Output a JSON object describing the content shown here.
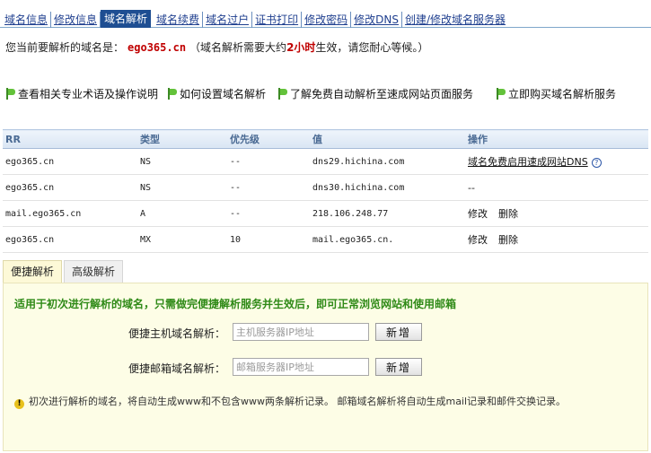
{
  "tabs": [
    {
      "label": "域名信息",
      "active": false
    },
    {
      "label": "修改信息",
      "active": false
    },
    {
      "label": "域名解析",
      "active": true
    },
    {
      "label": "域名续费",
      "active": false
    },
    {
      "label": "域名过户",
      "active": false
    },
    {
      "label": "证书打印",
      "active": false
    },
    {
      "label": "修改密码",
      "active": false
    },
    {
      "label": "修改DNS",
      "active": false
    },
    {
      "label": "创建/修改域名服务器",
      "active": false
    }
  ],
  "notice": {
    "prefix": "您当前要解析的域名是：",
    "domain": "ego365.cn",
    "mid": "（域名解析需要大约",
    "hours": "2小时",
    "suffix": "生效，请您耐心等候。）"
  },
  "help_links": [
    "查看相关专业术语及操作说明",
    "如何设置域名解析",
    "了解免费自动解析至速成网站页面服务",
    "立即购买域名解析服务"
  ],
  "table": {
    "headers": [
      "RR",
      "类型",
      "优先级",
      "值",
      "操作"
    ],
    "rows": [
      {
        "rr": "ego365.cn",
        "type": "NS",
        "priority": "--",
        "value": "dns29.hichina.com",
        "op_text": "域名免费启用速成网站DNS"
      },
      {
        "rr": "ego365.cn",
        "type": "NS",
        "priority": "--",
        "value": "dns30.hichina.com",
        "op_text": "--"
      },
      {
        "rr": "mail.ego365.cn",
        "type": "A",
        "priority": "--",
        "value": "218.106.248.77",
        "edit": "修改",
        "delete": "删除"
      },
      {
        "rr": "ego365.cn",
        "type": "MX",
        "priority": "10",
        "value": "mail.ego365.cn.",
        "edit": "修改",
        "delete": "删除"
      }
    ]
  },
  "panel_tabs": [
    {
      "label": "便捷解析",
      "active": true
    },
    {
      "label": "高级解析",
      "active": false
    }
  ],
  "panel": {
    "description": "适用于初次进行解析的域名，只需做完便捷解析服务并生效后，即可正常浏览网站和使用邮箱",
    "host_label": "便捷主机域名解析：",
    "host_placeholder": "主机服务器IP地址",
    "mail_label": "便捷邮箱域名解析：",
    "mail_placeholder": "邮箱服务器IP地址",
    "add_label": "新增",
    "note": "初次进行解析的域名，将自动生成www和不包含www两条解析记录。 邮箱域名解析将自动生成mail记录和邮件交换记录。"
  },
  "colors": {
    "tab_active_bg": "#1e4e92",
    "domain_red": "#c00000",
    "panel_green_text": "#2f8a17",
    "panel_bg": "#fdfde6"
  }
}
